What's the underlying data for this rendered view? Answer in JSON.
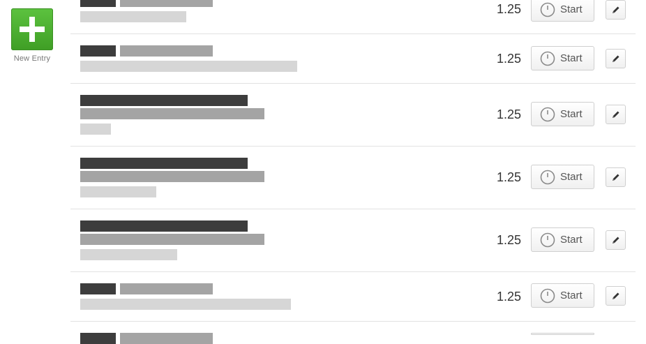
{
  "sidebar": {
    "new_entry_label": "New Entry",
    "new_entry_icon": "plus-icon",
    "accent": "#4caf32"
  },
  "entries": [
    {
      "hours": "1.25",
      "start_label": "Start"
    },
    {
      "hours": "1.25",
      "start_label": "Start"
    },
    {
      "hours": "1.25",
      "start_label": "Start"
    },
    {
      "hours": "1.25",
      "start_label": "Start"
    },
    {
      "hours": "1.25",
      "start_label": "Start"
    },
    {
      "hours": "1.25",
      "start_label": "Start"
    },
    {
      "hours": "",
      "start_label": ""
    }
  ],
  "icons": {
    "start": "stopwatch-icon",
    "edit": "pencil-icon"
  }
}
